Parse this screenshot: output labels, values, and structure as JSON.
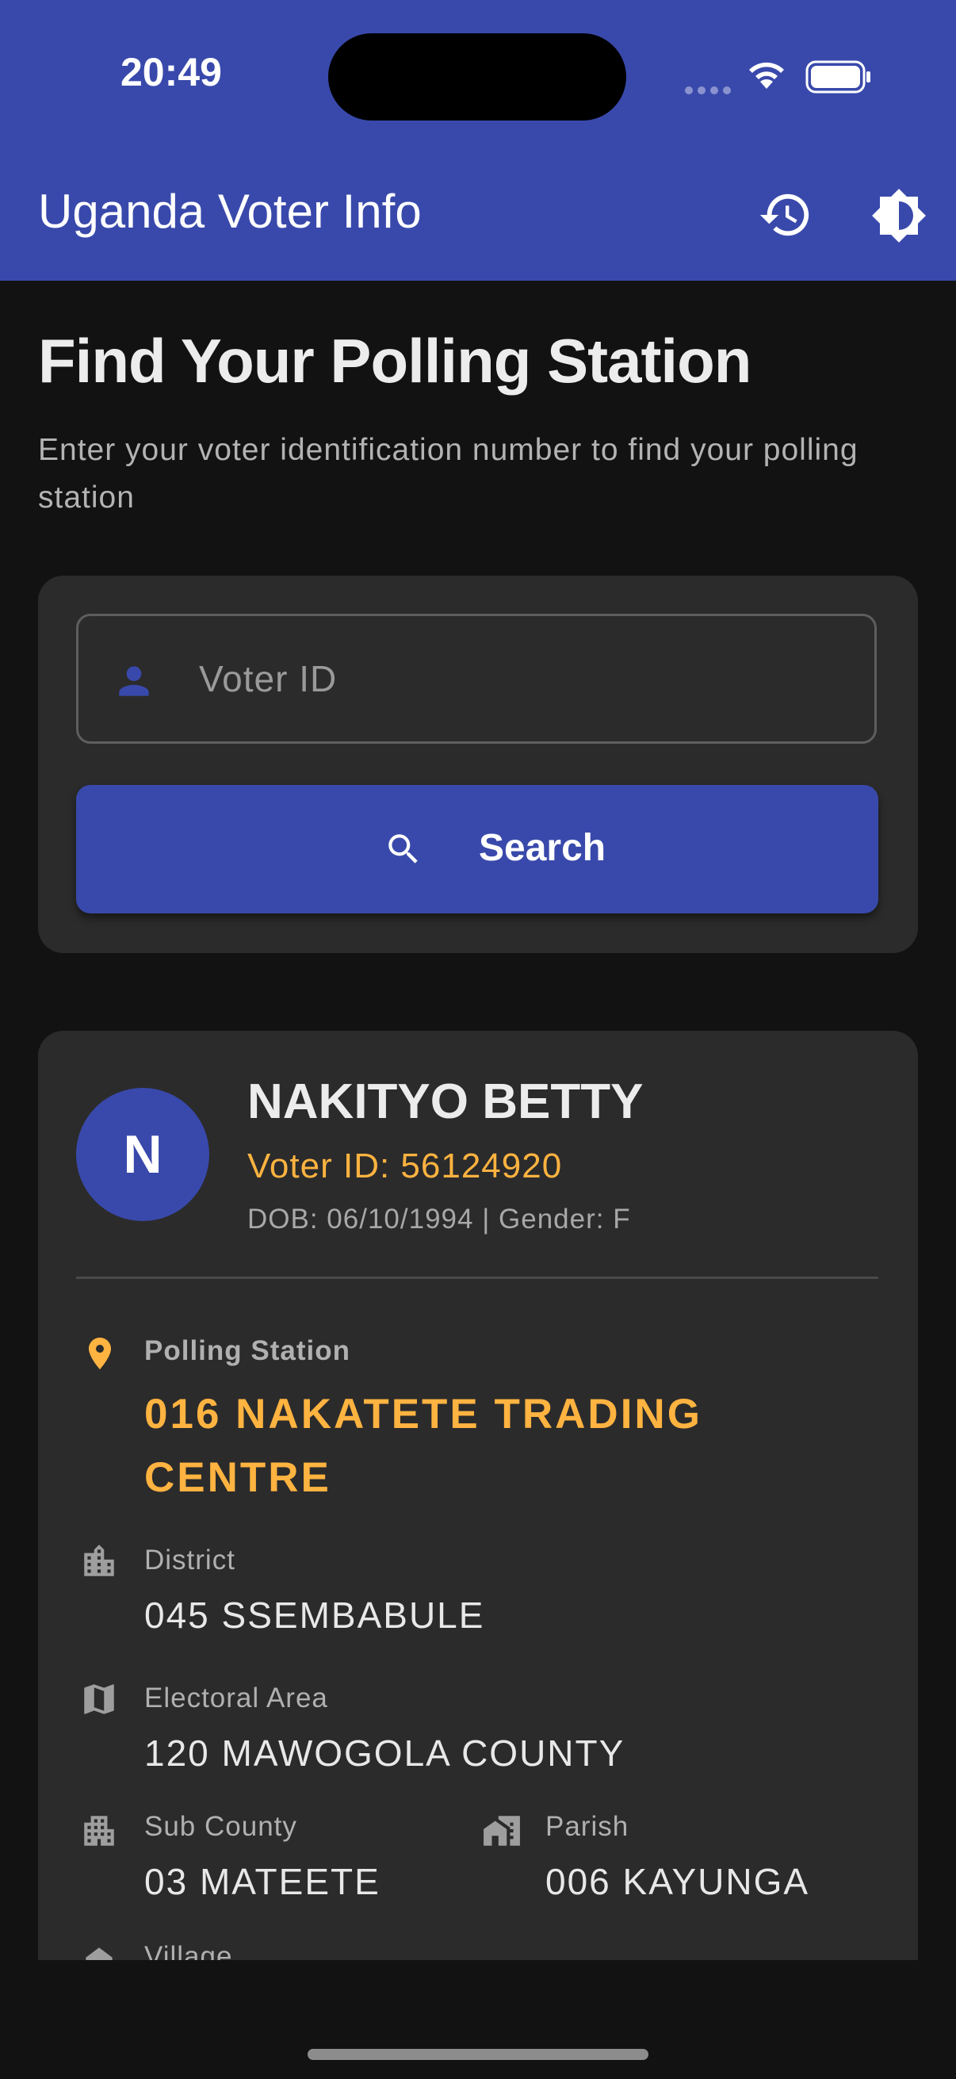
{
  "status_bar": {
    "time": "20:49"
  },
  "app_bar": {
    "title": "Uganda Voter Info",
    "history_icon": "history-icon",
    "theme_icon": "brightness-icon"
  },
  "search": {
    "title": "Find Your Polling Station",
    "subtitle": "Enter your voter identification number to find your polling station",
    "input_placeholder": "Voter ID",
    "input_value": "",
    "button_label": "Search"
  },
  "result": {
    "avatar_initial": "N",
    "name": "NAKITYO BETTY",
    "voter_id_line": "Voter ID: 56124920",
    "dob_gender_line": "DOB: 06/10/1994 | Gender: F",
    "polling_station_label": "Polling Station",
    "polling_station_value": "016 NAKATETE TRADING CENTRE",
    "district_label": "District",
    "district_value": "045 SSEMBABULE",
    "electoral_area_label": "Electoral Area",
    "electoral_area_value": "120 MAWOGOLA COUNTY",
    "sub_county_label": "Sub County",
    "sub_county_value": "03 MATEETE",
    "parish_label": "Parish",
    "parish_value": "006 KAYUNGA",
    "village_label": "Village"
  },
  "colors": {
    "primary": "#3949ab",
    "accent": "#ffb340",
    "background": "#121212",
    "card": "#2b2b2b"
  }
}
